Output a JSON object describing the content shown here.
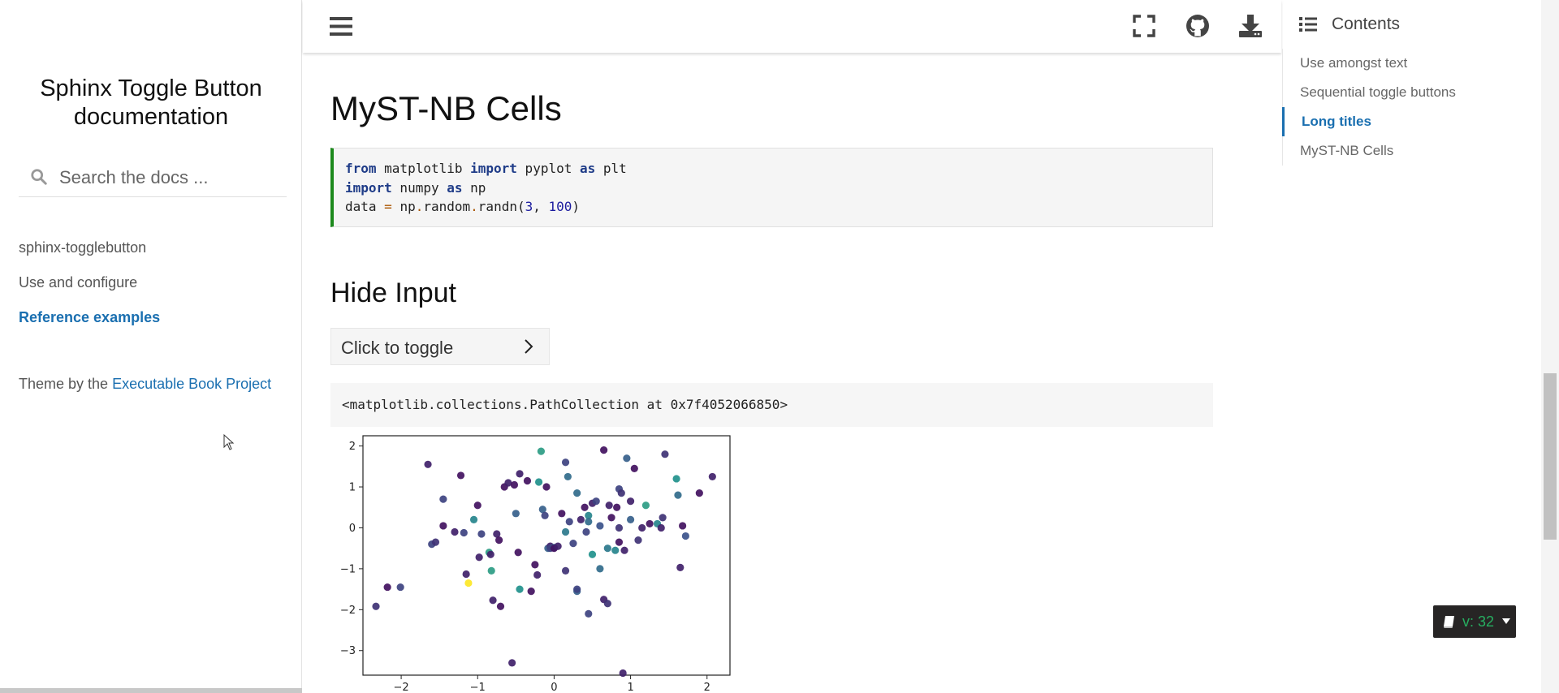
{
  "sidebar": {
    "site_title": "Sphinx Toggle Button documentation",
    "search_placeholder": "Search the docs ...",
    "nav": [
      {
        "label": "sphinx-togglebutton",
        "active": false
      },
      {
        "label": "Use and configure",
        "active": false
      },
      {
        "label": "Reference examples",
        "active": true
      }
    ],
    "theme_prefix": "Theme by the ",
    "theme_link": "Executable Book Project"
  },
  "topbar": {
    "icons": [
      "menu-icon",
      "fullscreen-icon",
      "github-icon",
      "download-icon"
    ]
  },
  "main": {
    "title": "MyST-NB Cells",
    "section_title": "Hide Input",
    "toggle_label": "Click to toggle",
    "output_text": "<matplotlib.collections.PathCollection at 0x7f4052066850>"
  },
  "toc": {
    "title": "Contents",
    "items": [
      {
        "label": "Use amongst text",
        "active": false
      },
      {
        "label": "Sequential toggle buttons",
        "active": false
      },
      {
        "label": "Long titles",
        "active": true
      },
      {
        "label": "MyST-NB Cells",
        "active": false
      }
    ]
  },
  "version_badge": {
    "label": "v: 32"
  },
  "colors": {
    "accent": "#1a6fb0",
    "code_border": "#1d8a1d",
    "badge_text": "#27ae60"
  },
  "chart_data": {
    "type": "scatter",
    "title": "",
    "xlabel": "",
    "ylabel": "",
    "xlim": [
      -2.5,
      2.3
    ],
    "ylim": [
      -3.6,
      2.25
    ],
    "xticks": [
      -2,
      -1,
      0,
      1,
      2
    ],
    "yticks": [
      2,
      1,
      0,
      -1,
      -2,
      -3
    ],
    "colormap": "viridis",
    "points": [
      [
        -2.33,
        -1.92,
        0.15
      ],
      [
        -2.18,
        -1.45,
        0.05
      ],
      [
        -2.01,
        -1.45,
        0.2
      ],
      [
        -1.65,
        1.55,
        0.1
      ],
      [
        -1.6,
        -0.4,
        0.2
      ],
      [
        -1.55,
        -0.35,
        0.15
      ],
      [
        -1.45,
        0.7,
        0.2
      ],
      [
        -1.45,
        0.05,
        0.05
      ],
      [
        -1.3,
        -0.1,
        0.1
      ],
      [
        -1.22,
        1.28,
        0.05
      ],
      [
        -1.18,
        -0.12,
        0.2
      ],
      [
        -1.15,
        -1.13,
        0.1
      ],
      [
        -1.12,
        -1.35,
        1.0
      ],
      [
        -1.05,
        0.2,
        0.45
      ],
      [
        -1.0,
        0.55,
        0.05
      ],
      [
        -0.98,
        -0.72,
        0.1
      ],
      [
        -0.95,
        -0.15,
        0.2
      ],
      [
        -0.85,
        -0.6,
        0.55
      ],
      [
        -0.83,
        -0.65,
        0.1
      ],
      [
        -0.82,
        -1.05,
        0.55
      ],
      [
        -0.8,
        -1.77,
        0.1
      ],
      [
        -0.75,
        -0.15,
        0.1
      ],
      [
        -0.72,
        -0.3,
        0.05
      ],
      [
        -0.7,
        -1.92,
        0.05
      ],
      [
        -0.65,
        1.0,
        0.05
      ],
      [
        -0.6,
        1.1,
        0.1
      ],
      [
        -0.55,
        -3.3,
        0.1
      ],
      [
        -0.52,
        1.05,
        0.05
      ],
      [
        -0.5,
        0.35,
        0.3
      ],
      [
        -0.47,
        -0.6,
        0.05
      ],
      [
        -0.45,
        -1.5,
        0.5
      ],
      [
        -0.45,
        1.32,
        0.1
      ],
      [
        -0.35,
        1.15,
        0.05
      ],
      [
        -0.3,
        -1.55,
        0.05
      ],
      [
        -0.25,
        -0.9,
        0.05
      ],
      [
        -0.22,
        -1.15,
        0.1
      ],
      [
        -0.2,
        1.12,
        0.5
      ],
      [
        -0.17,
        1.87,
        0.55
      ],
      [
        -0.15,
        0.45,
        0.3
      ],
      [
        -0.12,
        0.3,
        0.2
      ],
      [
        -0.1,
        1.0,
        0.05
      ],
      [
        -0.08,
        -0.5,
        0.3
      ],
      [
        -0.05,
        -0.45,
        0.1
      ],
      [
        -0.05,
        -0.5,
        0.2
      ],
      [
        0.0,
        -0.48,
        0.3
      ],
      [
        0.0,
        -0.5,
        0.05
      ],
      [
        0.05,
        -0.45,
        0.1
      ],
      [
        0.1,
        0.35,
        0.05
      ],
      [
        0.15,
        -1.05,
        0.15
      ],
      [
        0.15,
        1.6,
        0.2
      ],
      [
        0.15,
        -0.1,
        0.4
      ],
      [
        0.18,
        1.25,
        0.35
      ],
      [
        0.2,
        0.15,
        0.2
      ],
      [
        0.25,
        -0.38,
        0.2
      ],
      [
        0.3,
        -1.55,
        0.3
      ],
      [
        0.3,
        0.85,
        0.35
      ],
      [
        0.3,
        -1.5,
        0.2
      ],
      [
        0.35,
        0.2,
        0.1
      ],
      [
        0.4,
        0.5,
        0.05
      ],
      [
        0.42,
        -0.1,
        0.2
      ],
      [
        0.45,
        -2.1,
        0.2
      ],
      [
        0.45,
        0.3,
        0.45
      ],
      [
        0.45,
        0.15,
        0.35
      ],
      [
        0.5,
        0.6,
        0.1
      ],
      [
        0.5,
        -0.65,
        0.5
      ],
      [
        0.55,
        0.65,
        0.2
      ],
      [
        0.6,
        -1.0,
        0.35
      ],
      [
        0.6,
        0.05,
        0.25
      ],
      [
        0.65,
        1.9,
        0.05
      ],
      [
        0.65,
        -1.75,
        0.1
      ],
      [
        0.7,
        -1.85,
        0.15
      ],
      [
        0.7,
        -0.5,
        0.4
      ],
      [
        0.72,
        0.55,
        0.1
      ],
      [
        0.75,
        0.25,
        0.05
      ],
      [
        0.8,
        -0.55,
        0.45
      ],
      [
        0.82,
        0.5,
        0.05
      ],
      [
        0.85,
        0.95,
        0.2
      ],
      [
        0.85,
        -0.35,
        0.05
      ],
      [
        0.85,
        0.0,
        0.15
      ],
      [
        0.88,
        0.85,
        0.15
      ],
      [
        0.9,
        -3.55,
        0.1
      ],
      [
        0.92,
        -0.55,
        0.1
      ],
      [
        0.95,
        1.7,
        0.3
      ],
      [
        1.0,
        0.2,
        0.3
      ],
      [
        1.0,
        0.65,
        0.1
      ],
      [
        1.05,
        1.45,
        0.05
      ],
      [
        1.1,
        -0.3,
        0.15
      ],
      [
        1.15,
        0.0,
        0.1
      ],
      [
        1.2,
        0.55,
        0.55
      ],
      [
        1.25,
        0.1,
        0.05
      ],
      [
        1.35,
        0.1,
        0.45
      ],
      [
        1.4,
        0.0,
        0.1
      ],
      [
        1.42,
        0.25,
        0.15
      ],
      [
        1.45,
        1.8,
        0.15
      ],
      [
        1.6,
        1.2,
        0.5
      ],
      [
        1.62,
        0.8,
        0.35
      ],
      [
        1.65,
        -0.97,
        0.1
      ],
      [
        1.68,
        0.05,
        0.05
      ],
      [
        1.72,
        -0.2,
        0.25
      ],
      [
        1.9,
        0.85,
        0.05
      ],
      [
        2.07,
        1.25,
        0.1
      ]
    ]
  }
}
